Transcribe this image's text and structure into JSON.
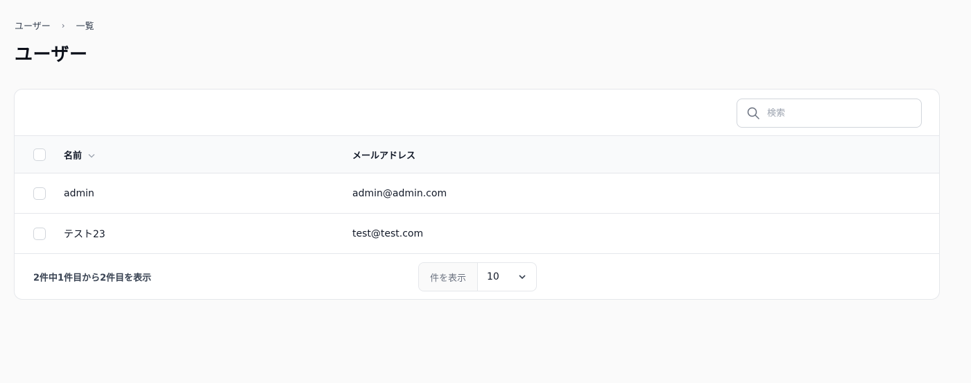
{
  "breadcrumb": {
    "items": [
      "ユーザー",
      "一覧"
    ],
    "separator": "›"
  },
  "page": {
    "title": "ユーザー"
  },
  "search": {
    "placeholder": "検索",
    "value": ""
  },
  "table": {
    "columns": {
      "name": "名前",
      "email": "メールアドレス"
    },
    "rows": [
      {
        "name": "admin",
        "email": "admin@admin.com"
      },
      {
        "name": "テスト23",
        "email": "test@test.com"
      }
    ]
  },
  "footer": {
    "summary": "2件中1件目から2件目を表示",
    "per_page_label": "件を表示",
    "per_page_value": "10"
  },
  "colors": {
    "border": "#e5e7eb",
    "background": "#fafafa",
    "text": "#111827"
  },
  "icons": {
    "search": "search-icon",
    "sort": "chevron-down-icon",
    "select": "chevron-down-icon"
  }
}
